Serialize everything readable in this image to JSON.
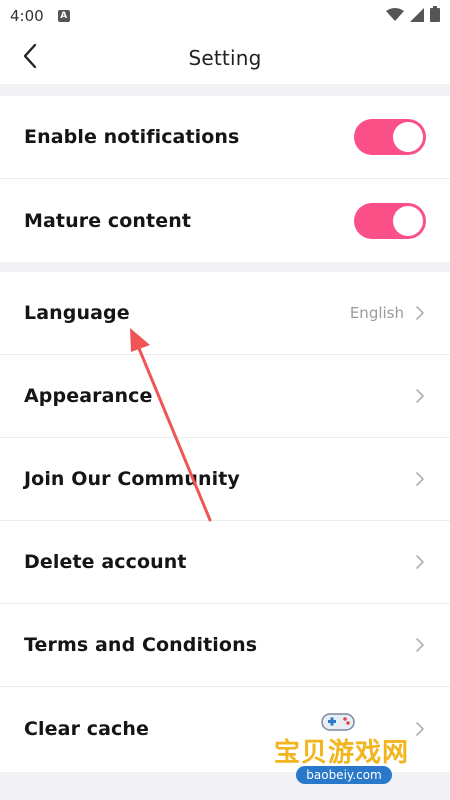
{
  "status_bar": {
    "time": "4:00",
    "a_badge": "A",
    "icons": [
      "wifi-icon",
      "signal-icon",
      "battery-icon"
    ]
  },
  "header": {
    "title": "Setting",
    "back_icon": "chevron-left-icon"
  },
  "toggles": [
    {
      "label": "Enable notifications",
      "on": true
    },
    {
      "label": "Mature content",
      "on": true
    }
  ],
  "menu": [
    {
      "label": "Language",
      "value": "English"
    },
    {
      "label": "Appearance"
    },
    {
      "label": "Join Our Community"
    },
    {
      "label": "Delete account"
    },
    {
      "label": "Terms and Conditions"
    },
    {
      "label": "Clear cache"
    }
  ],
  "watermark": {
    "text": "宝贝游戏网",
    "url": "baobeiy.com"
  },
  "colors": {
    "accent": "#fb4f87",
    "arrow": "#f05454",
    "background": "#f2f2f4"
  }
}
